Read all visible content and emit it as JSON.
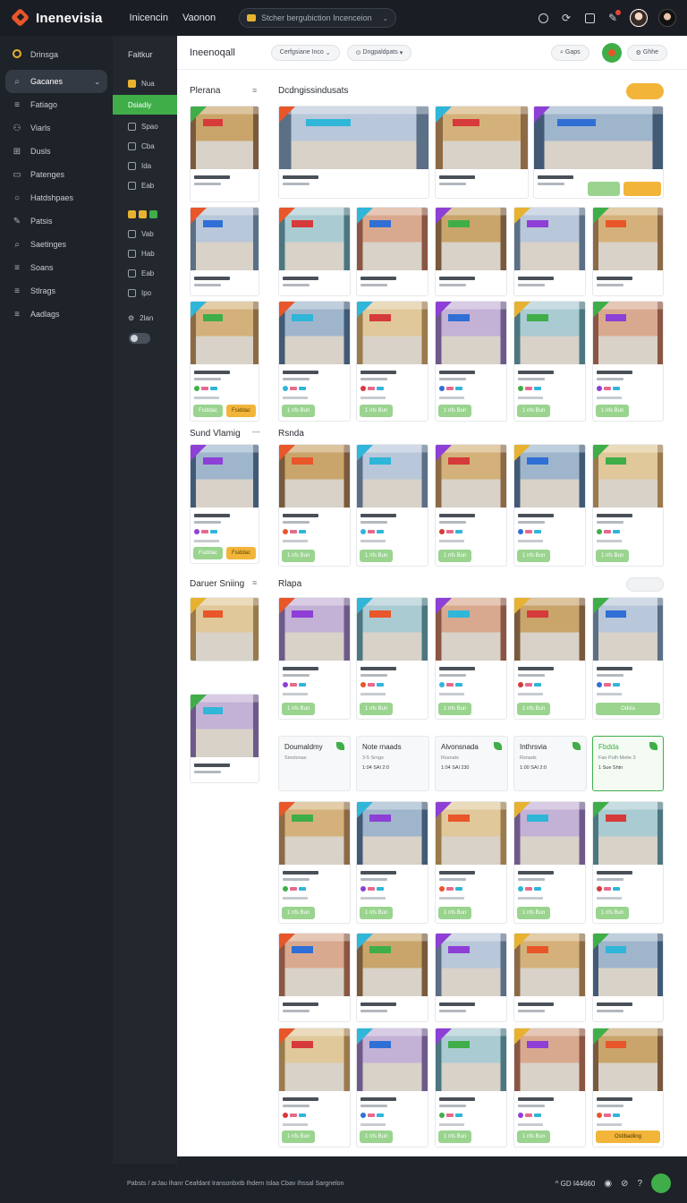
{
  "topbar": {
    "brand": "Inenevisia",
    "nav": [
      "Inicencin",
      "Vaonon"
    ],
    "search_placeholder": "Stcher bergubiction Incenceion"
  },
  "sidebar": {
    "items": [
      {
        "label": "Drinsga",
        "icon": "ring-icon"
      },
      {
        "label": "Gacanes",
        "icon": "search-icon"
      },
      {
        "label": "Fatiago",
        "icon": "list-icon"
      },
      {
        "label": "Viarls",
        "icon": "users-icon"
      },
      {
        "label": "Dusls",
        "icon": "grid-icon"
      },
      {
        "label": "Patenges",
        "icon": "folder-icon"
      },
      {
        "label": "Hatdshpaes",
        "icon": "circle-icon"
      },
      {
        "label": "Patsis",
        "icon": "pen-icon"
      },
      {
        "label": "Saetinges",
        "icon": "search-icon"
      },
      {
        "label": "Soans",
        "icon": "menu-icon"
      },
      {
        "label": "Stlrags",
        "icon": "menu-icon"
      },
      {
        "label": "Aadlags",
        "icon": "menu-icon"
      }
    ]
  },
  "filters": {
    "title": "Faitkur",
    "rows": [
      "Nua",
      "Dsiadiy",
      "Spao",
      "Cba",
      "Ida",
      "Eab",
      "Vab",
      "Hab",
      "Eab",
      "Ipo",
      "2lan"
    ]
  },
  "main": {
    "title": "Ineenoqall",
    "pills": [
      "Cerfgsiane Inco",
      "Dngpaldpats"
    ],
    "head_right": [
      "Gaps",
      "Ghhe"
    ],
    "sections": [
      {
        "left": "Plerana",
        "right": "Dcdngissindusats"
      },
      {
        "left": "Sund Vlamig",
        "right": "Rsnda"
      },
      {
        "left": "Daruer Sniing",
        "right": "Rlapa"
      }
    ],
    "features": [
      {
        "title": "Doumaldmy",
        "sub": "Smotsnas",
        "price": ""
      },
      {
        "title": "Note rnaads",
        "sub": "3-5 Srngs",
        "price": "1:04 SAl 2:0"
      },
      {
        "title": "Alvonsnada",
        "sub": "Rssnats",
        "price": "1:04 SAl 230"
      },
      {
        "title": "Inthrsvia",
        "sub": "Rsnads",
        "price": "1:00 SAl 2:0"
      },
      {
        "title": "Fbdda",
        "sub": "Fan Pulh Meite 3",
        "price": "1 Sue Shtn"
      }
    ],
    "card_btn": "1 nfs Bun",
    "card_btn_alt": "Fsiddac",
    "card_btn_wide": "Odsla",
    "card_btn_orange": "Ostibadiing"
  },
  "footer": {
    "text": "Pabsts / arJau Ihanr Ceafdant Iransonbxtb Ihdern Islaa Cbav Ihssal Sargnelon",
    "right_label": "GD I44660"
  },
  "colors": {
    "accent_green": "#3fae49",
    "accent_orange": "#f2b53a",
    "brand": "#e8562a"
  }
}
